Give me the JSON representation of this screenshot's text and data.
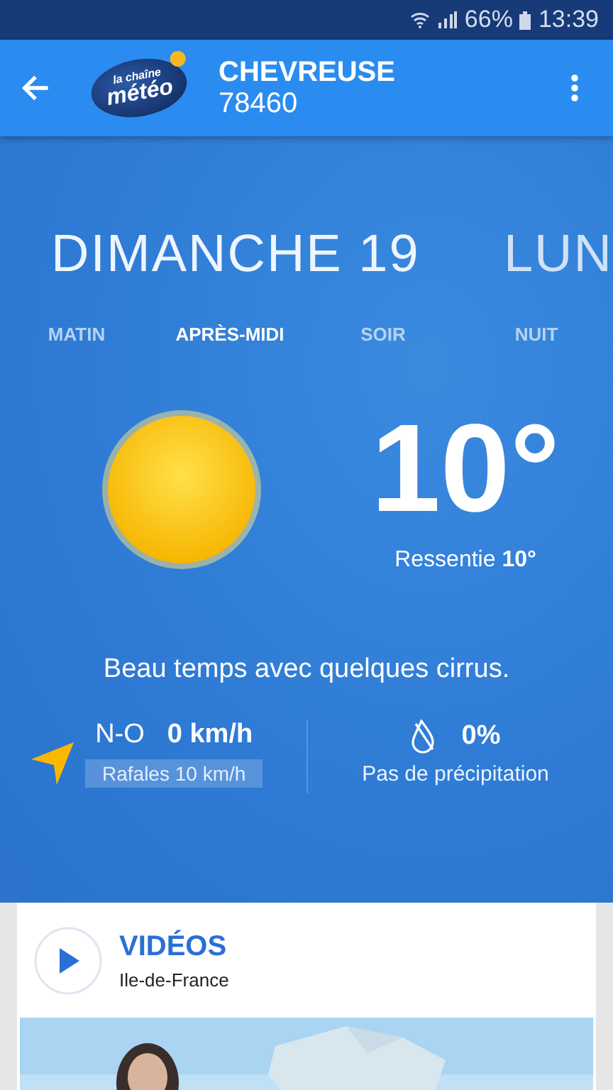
{
  "status_bar": {
    "battery": "66%",
    "time": "13:39"
  },
  "app_bar": {
    "logo": {
      "top": "la chaîne",
      "main": "météo"
    },
    "city": "CHEVREUSE",
    "postcode": "78460"
  },
  "days": [
    {
      "label": "DIMANCHE 19",
      "selected": true
    },
    {
      "label": "LUN",
      "selected": false
    }
  ],
  "periods": [
    {
      "label": "MATIN",
      "selected": false
    },
    {
      "label": "APRÈS-MIDI",
      "selected": true
    },
    {
      "label": "SOIR",
      "selected": false
    },
    {
      "label": "NUIT",
      "selected": false
    }
  ],
  "current": {
    "temperature": "10°",
    "feels_label": "Ressentie",
    "feels_value": "10°",
    "description": "Beau temps avec quelques cirrus."
  },
  "wind": {
    "direction": "N-O",
    "speed": "0 km/h",
    "gusts": "Rafales 10 km/h"
  },
  "rain": {
    "chance": "0%",
    "text": "Pas de précipitation"
  },
  "videos": {
    "title": "VIDÉOS",
    "region": "Ile-de-France"
  }
}
